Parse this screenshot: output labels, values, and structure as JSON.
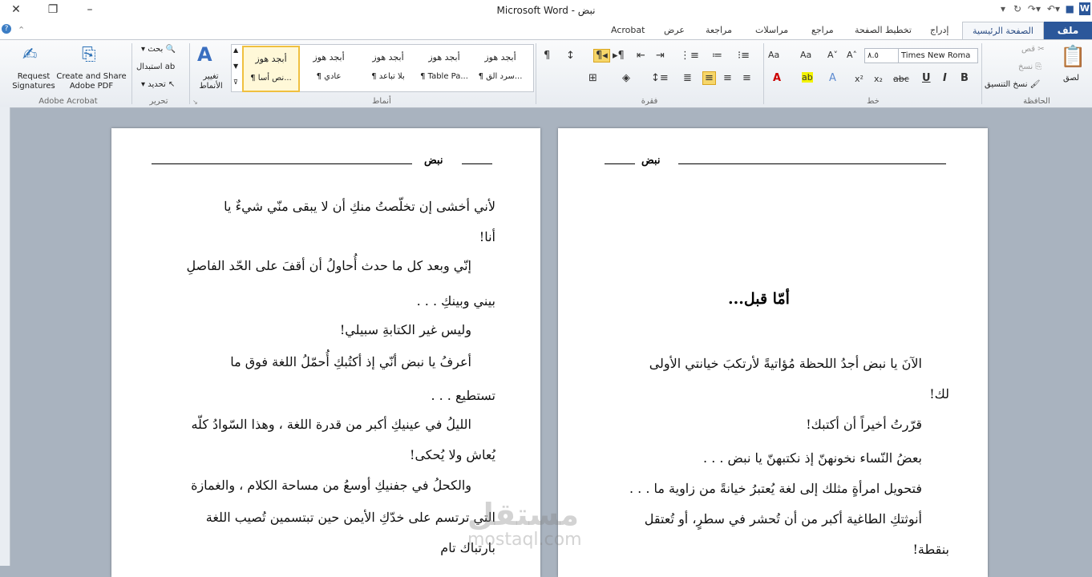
{
  "app": {
    "title": "نبض - Microsoft Word"
  },
  "tabs": {
    "file": "ملف",
    "home": "الصفحة الرئيسية",
    "insert": "إدراج",
    "layout": "تخطيط الصفحة",
    "references": "مراجع",
    "mailings": "مراسلات",
    "review": "مراجعة",
    "view": "عرض",
    "acrobat": "Acrobat"
  },
  "ribbon": {
    "clipboard": {
      "label": "الحافظة",
      "paste": "لصق",
      "cut": "قص",
      "copy": "نسخ",
      "format_painter": "نسخ التنسيق"
    },
    "font": {
      "label": "خط",
      "name": "Times New Roma",
      "size": "٨.٥"
    },
    "paragraph": {
      "label": "فقرة"
    },
    "styles": {
      "label": "أنماط",
      "change_styles": "تغيير الأنماط",
      "items": [
        {
          "sample": "أبجد هوز",
          "name": "¶ سرد الق..."
        },
        {
          "sample": "أبجد هوز",
          "name": "¶ Table Pa..."
        },
        {
          "sample": "أبجد هوز",
          "name": "¶ بلا تباعد"
        },
        {
          "sample": "أبجد هوز",
          "name": "¶ عادي"
        },
        {
          "sample": "أبجد هوز",
          "name": "¶ نص أسا..."
        }
      ]
    },
    "editing": {
      "label": "تحرير",
      "find": "بحث",
      "replace": "استبدال",
      "select": "تحديد"
    },
    "acrobat": {
      "label": "Adobe Acrobat",
      "request": "Request Signatures",
      "create": "Create and Share Adobe PDF"
    }
  },
  "doc": {
    "header_title": "نبض",
    "right_page": {
      "heading": "أمّا قبل...",
      "lines": [
        "الآنَ يا نبض أجدُ اللحظة مُؤاتيةً لأرتكبَ خيانتي الأولى",
        "لك!",
        "قرّرتُ أخيراً أن أكتبك!",
        "بعضُ النّساء نخونهنّ إذ نكتبهنّ يا نبض . . .",
        "فتحويل امرأةٍ مثلك إلى لغة يُعتبرُ خيانةً من زاوية ما . . .",
        "أنوثتكِ الطاغية أكبر من أن تُحشر في سطرٍ، أو تُعتقل",
        "بنقطة!"
      ]
    },
    "left_page": {
      "lines": [
        "لأني أخشى إن تخلّصتُ منكِ أن لا يبقى منّي شيءٌ يا",
        "أنا!",
        "إنّي وبعد كل ما حدث أُحاولُ أن أقفَ على الحّد الفاصلِ",
        "بيني وبينكِ . . .",
        "وليس غير الكتابةِ سبيلي!",
        "أعرفُ يا نبض أنّي إذ أكتُبكِ أُحمّلُ اللغة فوق ما",
        "تستطيع . . .",
        "الليلُ في عينيكِ أكبر من قدرة اللغة ، وهذا السّوادُ كلّه",
        "يُعاش ولا يُحكى!",
        "والكحلُ في جفنيكِ أوسعُ من مساحة الكلام ، والغمازة",
        "التي ترتسم على خدّكِ الأيمن حين تبتسمين تُصيب اللغة",
        "بارتباك تام"
      ]
    },
    "watermark": "mostaql.com"
  }
}
